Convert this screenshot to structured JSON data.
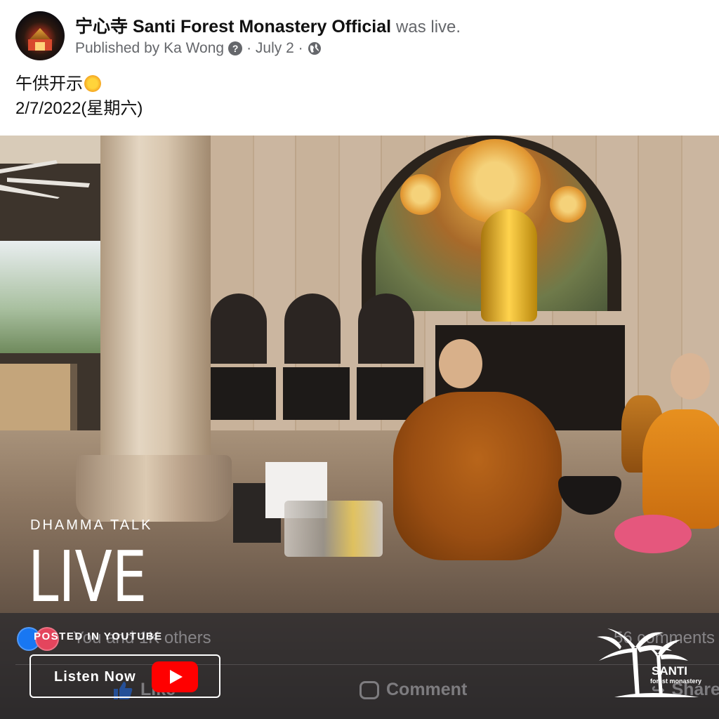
{
  "post": {
    "page_name": "宁心寺 Santi Forest Monastery Official",
    "status": "was live.",
    "published_by": "Published by Ka Wong",
    "date": "· July 2 ·",
    "text_line1": "午供开示",
    "text_line2": "2/7/2022(星期六)"
  },
  "overlay": {
    "category": "DHAMMA TALK",
    "headline": "LIVE",
    "posted_in": "POSTED IN YOUTUBE",
    "cta_label": "Listen Now",
    "logo_name": "SANTI",
    "logo_sub": "forest monastery"
  },
  "footer": {
    "reactions_text": "You and 1K others",
    "comments_count": "56 comments",
    "like_label": "Like",
    "comment_label": "Comment",
    "share_label": "Share"
  },
  "colors": {
    "facebook_blue": "#1877f2",
    "youtube_red": "#ff0000",
    "love_red": "#e4455d"
  }
}
